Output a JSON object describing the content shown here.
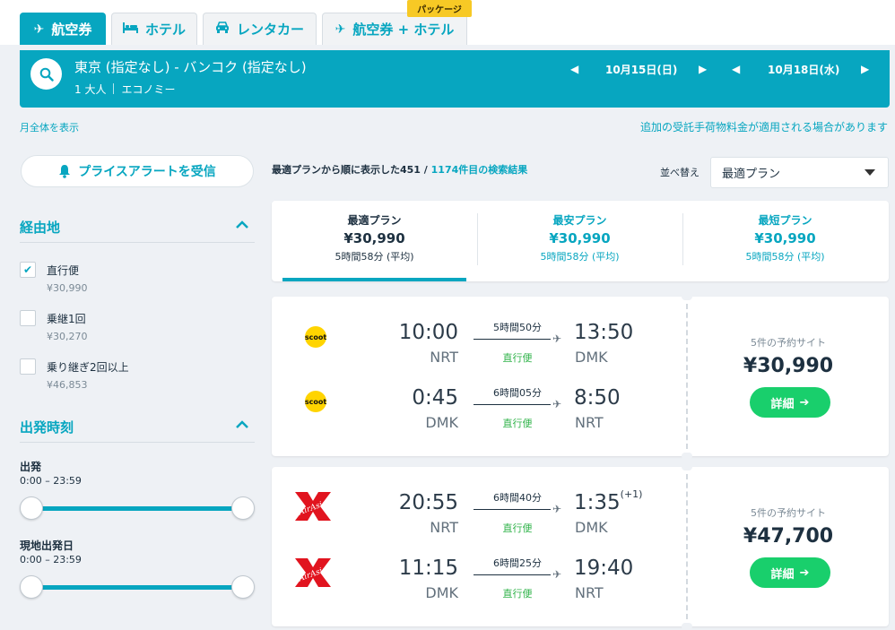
{
  "tabs": [
    {
      "label": "航空券",
      "icon": "airplane-icon",
      "active": true
    },
    {
      "label": "ホテル",
      "icon": "bed-icon",
      "active": false
    },
    {
      "label": "レンタカー",
      "icon": "car-icon",
      "active": false
    },
    {
      "label": "航空券 + ホテル",
      "icon": "airplane-hotel-icon",
      "active": false
    }
  ],
  "package_badge": "パッケージ",
  "search": {
    "route": "東京 (指定なし) - バンコク (指定なし)",
    "passengers": "1 大人",
    "cabin": "エコノミー",
    "depart_date": "10月15日(日)",
    "return_date": "10月18日(水)"
  },
  "links": {
    "month_view": "月全体を表示",
    "baggage_notice": "追加の受託手荷物料金が適用される場合があります"
  },
  "sidebar": {
    "price_alert": "プライスアラートを受信",
    "stops": {
      "title": "経由地",
      "options": [
        {
          "label": "直行便",
          "price": "¥30,990",
          "checked": true
        },
        {
          "label": "乗継1回",
          "price": "¥30,270",
          "checked": false
        },
        {
          "label": "乗り継ぎ2回以上",
          "price": "¥46,853",
          "checked": false
        }
      ]
    },
    "departure_time": {
      "title": "出発時刻",
      "groups": [
        {
          "label": "出発",
          "range": "0:00 – 23:59"
        },
        {
          "label": "現地出発日",
          "range": "0:00 – 23:59"
        }
      ]
    }
  },
  "results": {
    "count_prefix": "最適プランから順に表示した451 / ",
    "count_highlight": "1174件目の検索結果",
    "sort_label": "並べ替え",
    "sort_value": "最適プラン"
  },
  "plans": [
    {
      "title": "最適プラン",
      "price": "¥30,990",
      "duration": "5時間58分 (平均)",
      "active": true
    },
    {
      "title": "最安プラン",
      "price": "¥30,990",
      "duration": "5時間58分 (平均)",
      "active": false
    },
    {
      "title": "最短プラン",
      "price": "¥30,990",
      "duration": "5時間58分 (平均)",
      "active": false
    }
  ],
  "cards": [
    {
      "airline_logo": "scoot",
      "legs": [
        {
          "dep_time": "10:00",
          "dep_airport": "NRT",
          "duration": "5時間50分",
          "stops": "直行便",
          "arr_time": "13:50",
          "arr_airport": "DMK",
          "day_offset": ""
        },
        {
          "dep_time": "0:45",
          "dep_airport": "DMK",
          "duration": "6時間05分",
          "stops": "直行便",
          "arr_time": "8:50",
          "arr_airport": "NRT",
          "day_offset": ""
        }
      ],
      "sites": "5件の予約サイト",
      "price": "¥30,990",
      "button": "詳細"
    },
    {
      "airline_logo": "AirAsia",
      "legs": [
        {
          "dep_time": "20:55",
          "dep_airport": "NRT",
          "duration": "6時間40分",
          "stops": "直行便",
          "arr_time": "1:35",
          "arr_airport": "DMK",
          "day_offset": "(+1)"
        },
        {
          "dep_time": "11:15",
          "dep_airport": "DMK",
          "duration": "6時間25分",
          "stops": "直行便",
          "arr_time": "19:40",
          "arr_airport": "NRT",
          "day_offset": ""
        }
      ],
      "sites": "5件の予約サイト",
      "price": "¥47,700",
      "button": "詳細"
    }
  ],
  "colors": {
    "accent": "#07a6c0",
    "green": "#19cf6c",
    "badge": "#f7c925",
    "airasia_red": "#e1141f",
    "scoot_yellow": "#ffd400"
  }
}
